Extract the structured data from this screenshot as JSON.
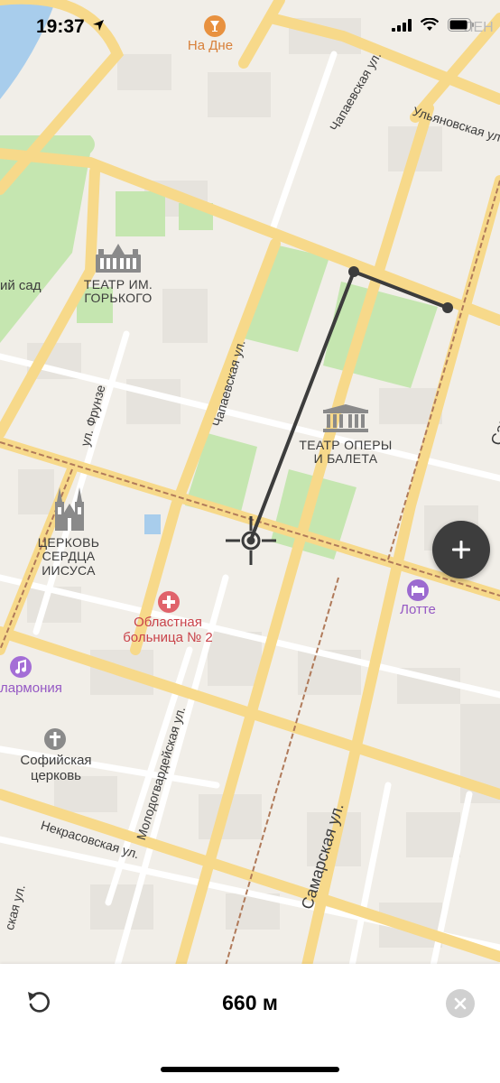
{
  "status_bar": {
    "time": "19:37"
  },
  "map": {
    "pois": [
      {
        "id": "na-dne",
        "label": "На Дне",
        "color": "#d8803a"
      },
      {
        "id": "teatr-gorkogo",
        "label_line1": "ТЕАТР ИМ.",
        "label_line2": "ГОРЬКОГО"
      },
      {
        "id": "teatr-opery",
        "label_line1": "ТЕАТР ОПЕРЫ",
        "label_line2": "И БАЛЕТА"
      },
      {
        "id": "tserkov-serdtsa",
        "label_line1": "ЦЕРКОВЬ",
        "label_line2": "СЕРДЦА",
        "label_line3": "ИИСУСА"
      },
      {
        "id": "bolnitsa",
        "label_line1": "Областная",
        "label_line2": "больница № 2",
        "color": "#c9434a"
      },
      {
        "id": "lotte",
        "label": "Лотте",
        "color": "#9558c4"
      },
      {
        "id": "filarmoniya",
        "label": "лармония",
        "color": "#9558c4"
      },
      {
        "id": "sofiyskaya",
        "label_line1": "Софийская",
        "label_line2": "церковь"
      },
      {
        "id": "sad",
        "label": "ий сад"
      }
    ],
    "streets": {
      "chapaevskaya_top": "Чапаевская ул.",
      "ulyanovskaya": "Ульяновская ул.",
      "chapaevskaya_mid": "Чапаевская ул.",
      "frunze": "ул. Фрунзе",
      "molodogvardeyskaya": "Молодогвардейская ул.",
      "nekrasovskaya": "Некрасовская ул.",
      "samarskaya": "Самарская ул.",
      "samarskaya_right": "Сам",
      "skaya_left": "ская ул.",
      "top_right": "ЛЕН"
    }
  },
  "measure": {
    "distance": "660 м"
  },
  "colors": {
    "road": "#f7d98a",
    "park": "#bfe3a8",
    "water": "#a8cdec",
    "route": "#3c3c3c",
    "rail": "#b07a5a"
  }
}
